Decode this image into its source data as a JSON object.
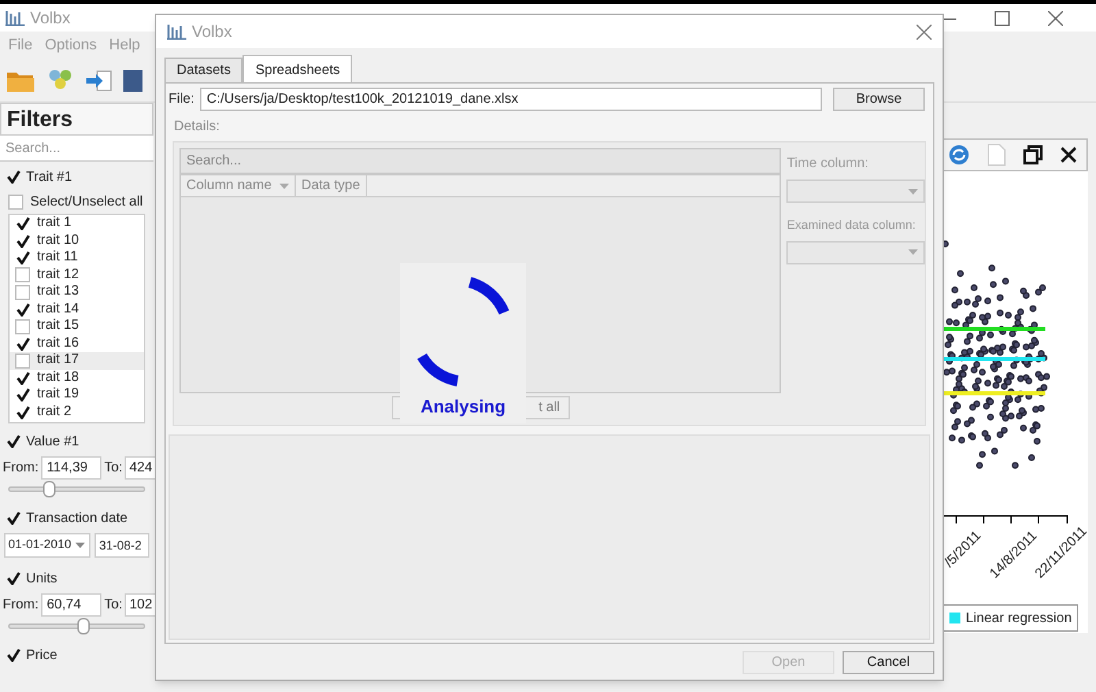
{
  "main_window": {
    "title": "Volbx",
    "menu": [
      "File",
      "Options",
      "Help"
    ]
  },
  "filters": {
    "title": "Filters",
    "search": {
      "placeholder": "Search..."
    },
    "groups": [
      {
        "kind": "list",
        "label": "Trait #1",
        "checked": true,
        "select_all": {
          "label": "Select/Unselect all",
          "checked": false
        },
        "items": [
          {
            "label": "trait 1",
            "checked": true,
            "selected": false
          },
          {
            "label": "trait 10",
            "checked": true,
            "selected": false
          },
          {
            "label": "trait 11",
            "checked": true,
            "selected": false
          },
          {
            "label": "trait 12",
            "checked": false,
            "selected": false
          },
          {
            "label": "trait 13",
            "checked": false,
            "selected": false
          },
          {
            "label": "trait 14",
            "checked": true,
            "selected": false
          },
          {
            "label": "trait 15",
            "checked": false,
            "selected": false
          },
          {
            "label": "trait 16",
            "checked": true,
            "selected": false
          },
          {
            "label": "trait 17",
            "checked": false,
            "selected": true
          },
          {
            "label": "trait 18",
            "checked": true,
            "selected": false
          },
          {
            "label": "trait 19",
            "checked": true,
            "selected": false
          },
          {
            "label": "trait 2",
            "checked": true,
            "selected": false
          }
        ]
      },
      {
        "kind": "range",
        "label": "Value #1",
        "checked": true,
        "from_label": "From:",
        "from": "114,39",
        "to_label": "To:",
        "to": "424",
        "level": 0.3
      },
      {
        "kind": "date",
        "label": "Transaction date",
        "checked": true,
        "from": "01-01-2010",
        "to": "31-08-2"
      },
      {
        "kind": "range",
        "label": "Units",
        "checked": true,
        "from_label": "From:",
        "from": "60,74",
        "to_label": "To:",
        "to": "102",
        "level": 0.55
      },
      {
        "kind": "header",
        "label": "Price",
        "checked": true
      }
    ]
  },
  "chart_panel": {
    "date_labels": [
      "/5/2011",
      "14/8/2011",
      "22/11/2011"
    ],
    "legend": [
      {
        "label": "Linear regression",
        "color": "#22e5f0"
      }
    ]
  },
  "dialog": {
    "title": "Volbx",
    "tabs": [
      {
        "label": "Datasets",
        "selected": false
      },
      {
        "label": "Spreadsheets",
        "selected": true
      }
    ],
    "file_label": "File:",
    "file_path": "C:/Users/ja/Desktop/test100k_20121019_dane.xlsx",
    "browse": "Browse",
    "details_label": "Details:",
    "search": {
      "placeholder": "Search..."
    },
    "columns": [
      "Column name",
      "Data type"
    ],
    "time_column_label": "Time column:",
    "examined_column_label": "Examined data column:",
    "partial_button": "t all",
    "loader_text": "Analysing",
    "buttons": [
      {
        "label": "Open",
        "disabled": true
      },
      {
        "label": "Cancel",
        "disabled": false
      }
    ]
  }
}
